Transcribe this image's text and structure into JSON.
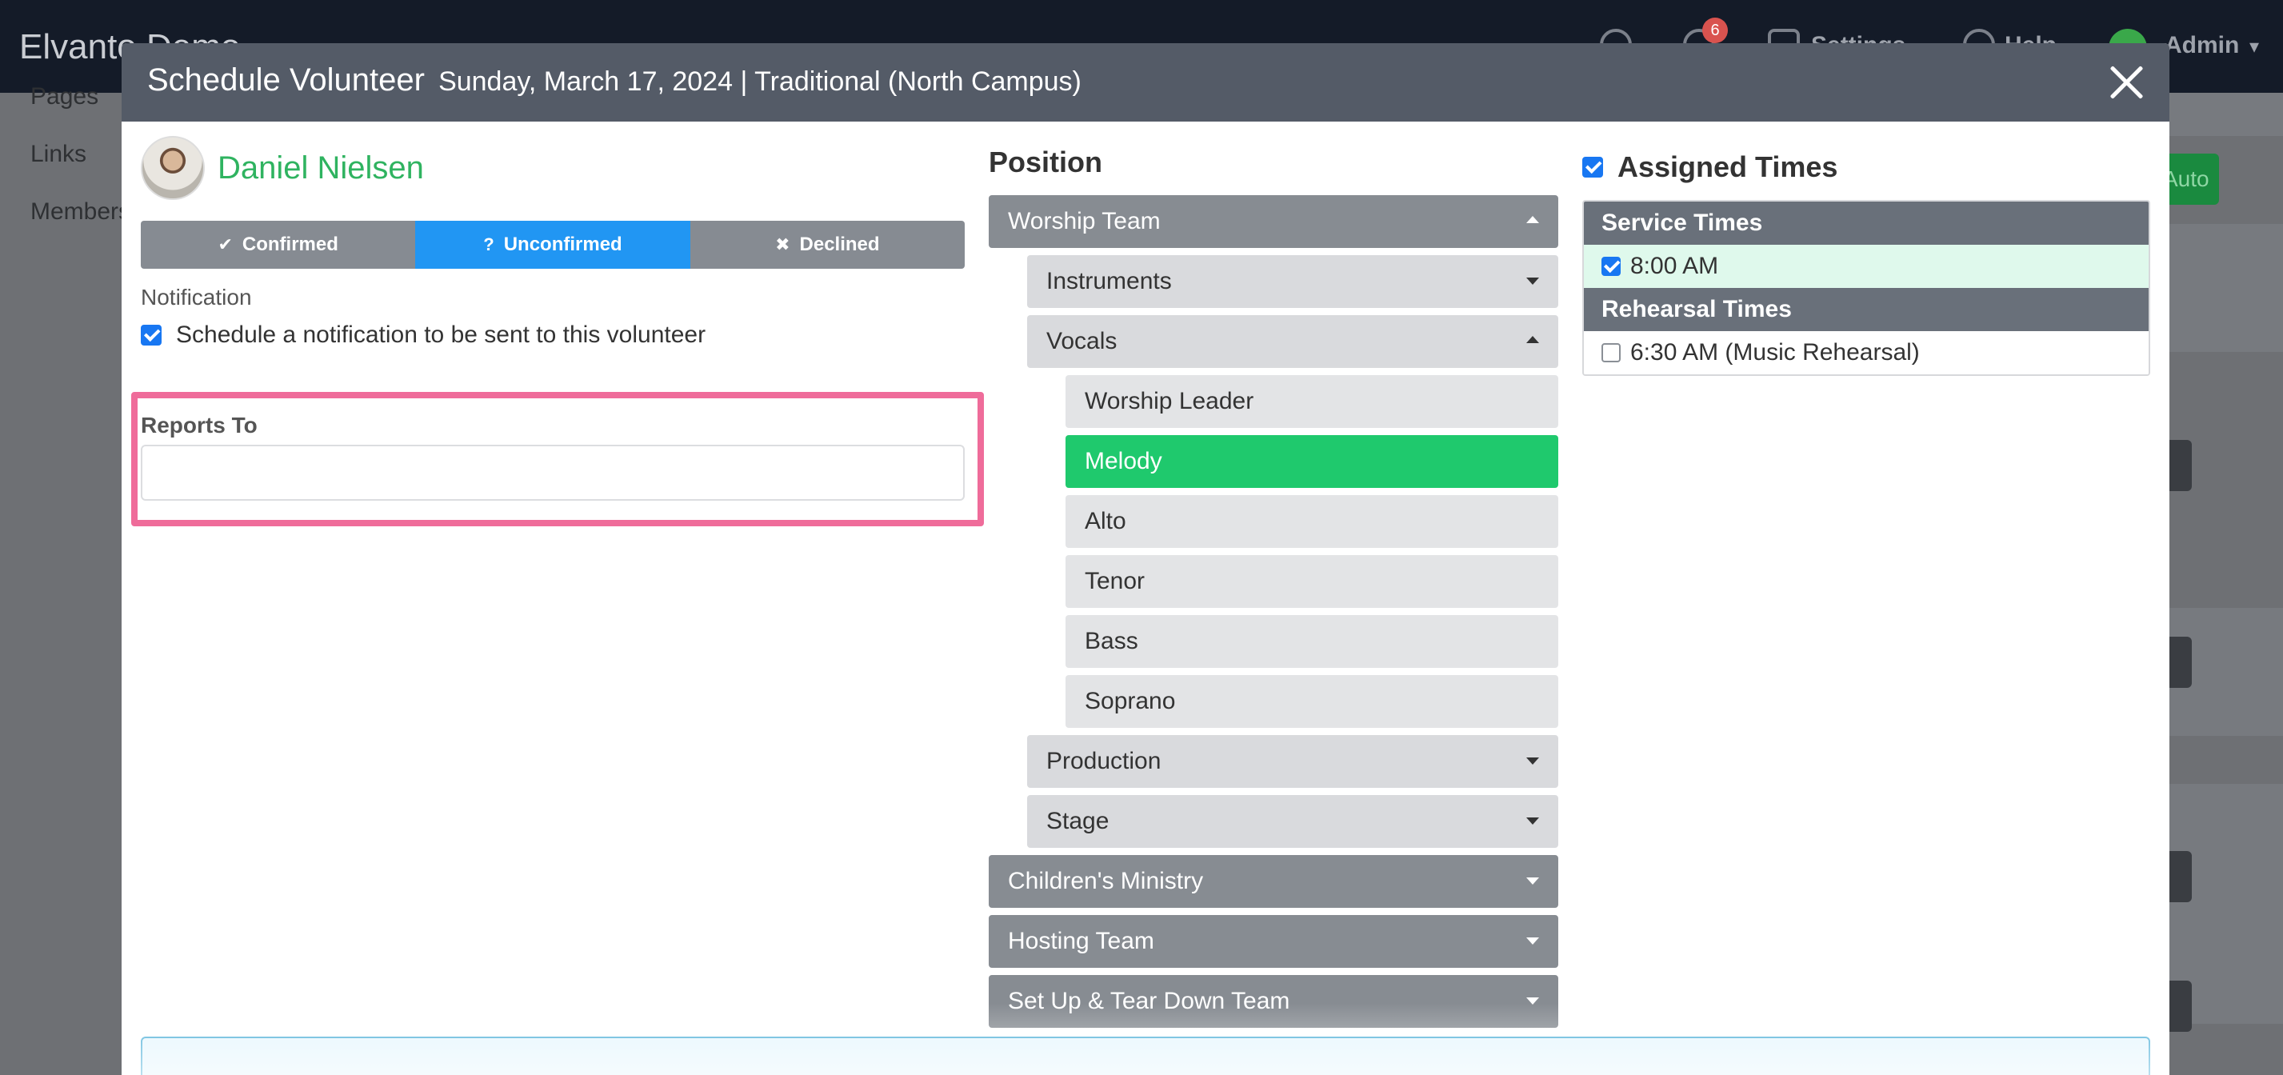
{
  "app": {
    "brand": "Elvanto Demo",
    "notification_count": "6",
    "nav": [
      "Settings",
      "Help"
    ],
    "admin_label": "Admin",
    "sidebar": [
      "Pages",
      "Links",
      "Members"
    ],
    "bg_button": "Auto"
  },
  "modal": {
    "title": "Schedule Volunteer",
    "subtitle": "Sunday, March 17, 2024 | Traditional (North Campus)"
  },
  "volunteer": {
    "name": "Daniel Nielsen",
    "status": {
      "confirmed": "Confirmed",
      "unconfirmed": "Unconfirmed",
      "declined": "Declined",
      "selected": "unconfirmed"
    },
    "notification_label": "Notification",
    "notification_checkbox": "Schedule a notification to be sent to this volunteer",
    "notification_checked": true,
    "reports_to_label": "Reports To",
    "reports_to_value": ""
  },
  "position": {
    "title": "Position",
    "items": [
      {
        "label": "Worship Team",
        "level": 0,
        "expanded": true
      },
      {
        "label": "Instruments",
        "level": 1,
        "expanded": false
      },
      {
        "label": "Vocals",
        "level": 1,
        "expanded": true
      },
      {
        "label": "Worship Leader",
        "level": 2
      },
      {
        "label": "Melody",
        "level": 2,
        "selected": true
      },
      {
        "label": "Alto",
        "level": 2
      },
      {
        "label": "Tenor",
        "level": 2
      },
      {
        "label": "Bass",
        "level": 2
      },
      {
        "label": "Soprano",
        "level": 2
      },
      {
        "label": "Production",
        "level": 1,
        "expanded": false
      },
      {
        "label": "Stage",
        "level": 1,
        "expanded": false
      },
      {
        "label": "Children's Ministry",
        "level": 0,
        "expanded": false
      },
      {
        "label": "Hosting Team",
        "level": 0,
        "expanded": false
      },
      {
        "label": "Set Up & Tear Down Team",
        "level": 0,
        "expanded": false
      }
    ]
  },
  "assigned_times": {
    "title": "Assigned Times",
    "checked": true,
    "service_header": "Service Times",
    "service_times": [
      {
        "label": "8:00 AM",
        "checked": true
      }
    ],
    "rehearsal_header": "Rehearsal Times",
    "rehearsal_times": [
      {
        "label": "6:30 AM (Music Rehearsal)",
        "checked": false
      }
    ]
  },
  "colors": {
    "accent_green": "#2fb360",
    "selected_position": "#1fc96d",
    "unconfirmed_blue": "#2196f3",
    "highlight_pink": "#ef6c9a",
    "modal_header": "#545b67"
  }
}
